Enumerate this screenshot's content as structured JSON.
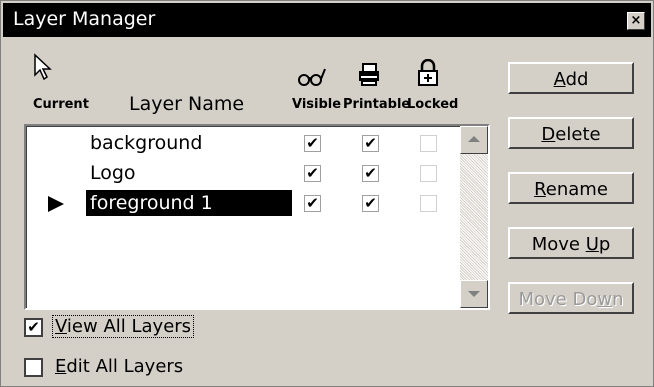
{
  "window": {
    "title": "Layer Manager",
    "close_glyph": "×"
  },
  "headers": {
    "current": "Current",
    "layer_name": "Layer Name",
    "visible": "Visible",
    "printable": "Printable",
    "locked": "Locked"
  },
  "icons": {
    "current": "arrow-cursor-icon",
    "visible": "glasses-icon",
    "printable": "printer-icon",
    "locked": "padlock-icon"
  },
  "layers": [
    {
      "name": "background",
      "current": false,
      "selected": false,
      "visible": true,
      "printable": true,
      "locked": false
    },
    {
      "name": "Logo",
      "current": false,
      "selected": false,
      "visible": true,
      "printable": true,
      "locked": false
    },
    {
      "name": "foreground 1",
      "current": true,
      "selected": true,
      "visible": true,
      "printable": true,
      "locked": false
    }
  ],
  "check_glyph": "✔",
  "buttons": [
    {
      "label_pre": "",
      "label_u": "A",
      "label_post": "dd",
      "enabled": true,
      "name": "add-button"
    },
    {
      "label_pre": "",
      "label_u": "D",
      "label_post": "elete",
      "enabled": true,
      "name": "delete-button"
    },
    {
      "label_pre": "",
      "label_u": "R",
      "label_post": "ename",
      "enabled": true,
      "name": "rename-button"
    },
    {
      "label_pre": "Move ",
      "label_u": "U",
      "label_post": "p",
      "enabled": true,
      "name": "move-up-button"
    },
    {
      "label_pre": "Move Do",
      "label_u": "w",
      "label_post": "n",
      "enabled": false,
      "name": "move-down-button"
    }
  ],
  "options": {
    "view_all": {
      "label_u": "V",
      "label_post": "iew All Layers",
      "checked": true
    },
    "edit_all": {
      "label_u": "E",
      "label_post": "dit All Layers",
      "checked": false
    }
  }
}
